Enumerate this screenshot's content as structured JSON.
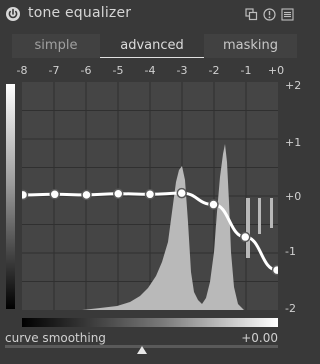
{
  "header": {
    "title": "tone equalizer",
    "icons": [
      "power-icon",
      "presets-icon",
      "reset-icon",
      "menu-icon"
    ]
  },
  "tabs": [
    {
      "label": "simple"
    },
    {
      "label": "advanced",
      "active": true
    },
    {
      "label": "masking"
    }
  ],
  "graph": {
    "ev_labels": [
      "-8",
      "-7",
      "-6",
      "-5",
      "-4",
      "-3",
      "-2",
      "-1",
      "+0"
    ],
    "right_labels": [
      "+2",
      "+1",
      "+0",
      "-1",
      "-2"
    ],
    "nodes_ev": [
      0.02,
      0.03,
      0.02,
      0.04,
      0.03,
      0.05,
      -0.15,
      -0.72,
      -1.3
    ],
    "colors": {
      "plot_bg": "#454545",
      "grid": "#303030",
      "histogram": "#b9b9b9",
      "curve": "#ffffff",
      "node_fill": "#ffffff",
      "node_stroke": "#5a5a5a",
      "page_bg": "#393939"
    }
  },
  "smoothing": {
    "label": "curve smoothing",
    "value": "+0.00"
  }
}
